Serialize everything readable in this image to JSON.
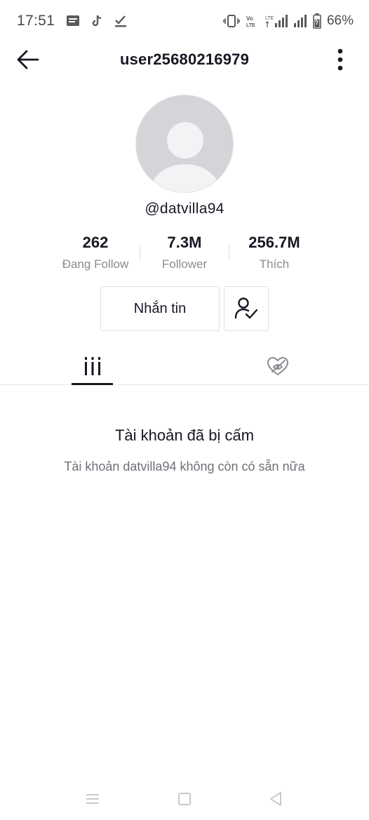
{
  "status_bar": {
    "time": "17:51",
    "battery_percent": "66%",
    "network_lte_label": "LTE",
    "volte_label": "Vo LTE",
    "left_icons": [
      "message-notification-icon",
      "tiktok-icon",
      "download-done-icon"
    ],
    "right_icons": [
      "vibrate-icon",
      "volte-icon",
      "lte-signal-icon",
      "signal-icon",
      "battery-icon"
    ]
  },
  "header": {
    "title": "user25680216979",
    "back_icon": "arrow-left-icon",
    "more_icon": "more-vertical-icon"
  },
  "profile": {
    "avatar": "default-avatar",
    "handle": "@datvilla94",
    "stats": [
      {
        "value": "262",
        "label": "Đang Follow"
      },
      {
        "value": "7.3M",
        "label": "Follower"
      },
      {
        "value": "256.7M",
        "label": "Thích"
      }
    ],
    "message_button_label": "Nhắn tin",
    "follow_status_icon": "user-check-icon"
  },
  "tabs": {
    "items": [
      {
        "name": "videos",
        "icon": "grid-bars-icon",
        "active": true
      },
      {
        "name": "liked",
        "icon": "heart-hidden-icon",
        "active": false
      }
    ]
  },
  "banned": {
    "title": "Tài khoản đã bị cấm",
    "description": "Tài khoản datvilla94 không còn có sẵn nữa"
  },
  "nav_bar": {
    "items": [
      "menu-icon",
      "home-square-icon",
      "back-triangle-icon"
    ]
  },
  "colors": {
    "text_primary": "#161823",
    "text_secondary": "#8a8b91",
    "avatar_bg": "#d6d4d8",
    "border": "#dedee2"
  }
}
